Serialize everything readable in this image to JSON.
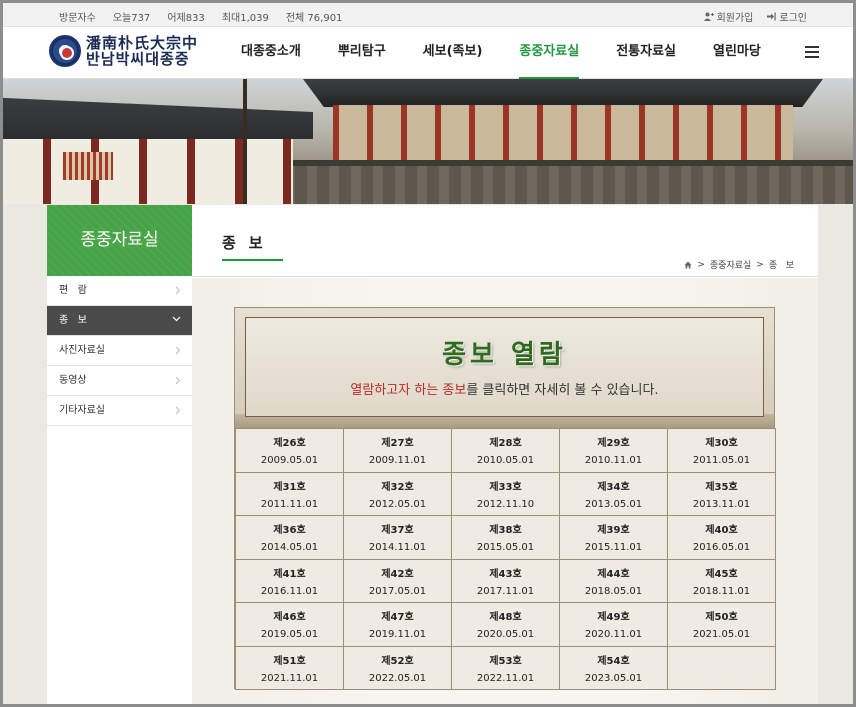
{
  "topbar": {
    "stats": [
      "방문자수",
      "오늘737",
      "어제833",
      "최대1,039",
      "전체 76,901"
    ],
    "join": "회원가입",
    "login": "로그인"
  },
  "logo": {
    "hanja": "潘南朴氏大宗中",
    "korean": "반남박씨대종중"
  },
  "gnb": [
    "대종중소개",
    "뿌리탐구",
    "세보(족보)",
    "종중자료실",
    "전통자료실",
    "열린마당"
  ],
  "gnb_active": "종중자료실",
  "snb": {
    "title": "종중자료실",
    "items": [
      "편   람",
      "종   보",
      "사진자료실",
      "동영상",
      "기타자료실"
    ]
  },
  "page": {
    "title": "종보",
    "breadcrumb": [
      "종중자료실",
      "종   보"
    ]
  },
  "banner": {
    "title": "종보 열람",
    "desc_highlight": "열람하고자 하는 종보",
    "desc_rest": "를 클릭하면 자세히 볼 수 있습니다."
  },
  "issues": [
    [
      {
        "no": "제26호",
        "date": "2009.05.01"
      },
      {
        "no": "제27호",
        "date": "2009.11.01"
      },
      {
        "no": "제28호",
        "date": "2010.05.01"
      },
      {
        "no": "제29호",
        "date": "2010.11.01"
      },
      {
        "no": "제30호",
        "date": "2011.05.01"
      }
    ],
    [
      {
        "no": "제31호",
        "date": "2011.11.01"
      },
      {
        "no": "제32호",
        "date": "2012.05.01"
      },
      {
        "no": "제33호",
        "date": "2012.11.10"
      },
      {
        "no": "제34호",
        "date": "2013.05.01"
      },
      {
        "no": "제35호",
        "date": "2013.11.01"
      }
    ],
    [
      {
        "no": "제36호",
        "date": "2014.05.01"
      },
      {
        "no": "제37호",
        "date": "2014.11.01"
      },
      {
        "no": "제38호",
        "date": "2015.05.01"
      },
      {
        "no": "제39호",
        "date": "2015.11.01"
      },
      {
        "no": "제40호",
        "date": "2016.05.01"
      }
    ],
    [
      {
        "no": "제41호",
        "date": "2016.11.01"
      },
      {
        "no": "제42호",
        "date": "2017.05.01"
      },
      {
        "no": "제43호",
        "date": "2017.11.01"
      },
      {
        "no": "제44호",
        "date": "2018.05.01"
      },
      {
        "no": "제45호",
        "date": "2018.11.01"
      }
    ],
    [
      {
        "no": "제46호",
        "date": "2019.05.01"
      },
      {
        "no": "제47호",
        "date": "2019.11.01"
      },
      {
        "no": "제48호",
        "date": "2020.05.01"
      },
      {
        "no": "제49호",
        "date": "2020.11.01"
      },
      {
        "no": "제50호",
        "date": "2021.05.01"
      }
    ],
    [
      {
        "no": "제51호",
        "date": "2021.11.01"
      },
      {
        "no": "제52호",
        "date": "2022.05.01"
      },
      {
        "no": "제53호",
        "date": "2022.11.01"
      },
      {
        "no": "제54호",
        "date": "2023.05.01"
      },
      null
    ]
  ],
  "colors": {
    "accent": "#21963c",
    "snb_title_bg": "#46a346",
    "highlight": "#c22a2a"
  }
}
